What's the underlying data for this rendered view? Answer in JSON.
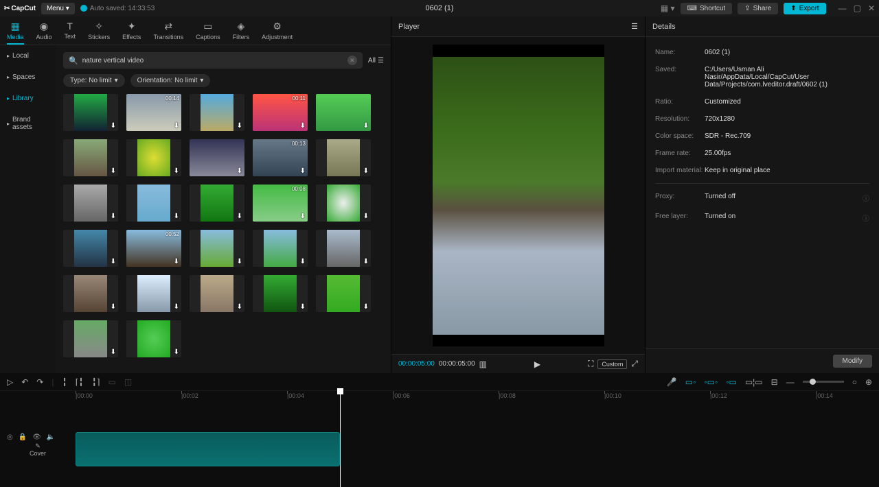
{
  "titlebar": {
    "logo": "CapCut",
    "menu": "Menu ▾",
    "autosave": "Auto saved: 14:33:53",
    "project": "0602 (1)",
    "shortcut": "Shortcut",
    "share": "Share",
    "export": "Export"
  },
  "tabs": [
    {
      "label": "Media",
      "icon": "▦"
    },
    {
      "label": "Audio",
      "icon": "◉"
    },
    {
      "label": "Text",
      "icon": "T"
    },
    {
      "label": "Stickers",
      "icon": "✧"
    },
    {
      "label": "Effects",
      "icon": "✦"
    },
    {
      "label": "Transitions",
      "icon": "⇄"
    },
    {
      "label": "Captions",
      "icon": "▭"
    },
    {
      "label": "Filters",
      "icon": "◈"
    },
    {
      "label": "Adjustment",
      "icon": "⚙"
    }
  ],
  "sidenav": [
    "Local",
    "Spaces",
    "Library",
    "Brand assets"
  ],
  "search": {
    "value": "nature vertical video",
    "all": "All"
  },
  "filters": {
    "type": "Type: No limit",
    "orientation": "Orientation: No limit"
  },
  "thumbs": [
    {
      "dur": "",
      "bg": "linear-gradient(#2a4, #123)"
    },
    {
      "dur": "00:14",
      "bg": "linear-gradient(#89a, #ccb)",
      "wide": true
    },
    {
      "dur": "",
      "bg": "linear-gradient(#5ad, #ba6)"
    },
    {
      "dur": "00:11",
      "bg": "linear-gradient(#f54, #b37)",
      "wide": true
    },
    {
      "dur": "",
      "bg": "linear-gradient(#5c5, #394)",
      "wide": true
    },
    {
      "dur": "",
      "bg": "linear-gradient(#8a7, #654)"
    },
    {
      "dur": "",
      "bg": "radial-gradient(#dd3, #6a2)"
    },
    {
      "dur": "",
      "bg": "linear-gradient(#335, #889)",
      "wide": true
    },
    {
      "dur": "00:13",
      "bg": "linear-gradient(#678, #345)",
      "wide": true
    },
    {
      "dur": "",
      "bg": "linear-gradient(#aa8, #775)"
    },
    {
      "dur": "",
      "bg": "linear-gradient(#aaa, #666)"
    },
    {
      "dur": "",
      "bg": "linear-gradient(#8bd, #6ac)"
    },
    {
      "dur": "",
      "bg": "linear-gradient(#3a3, #171)"
    },
    {
      "dur": "00:08",
      "bg": "linear-gradient(#4b4, #8c8)",
      "wide": true
    },
    {
      "dur": "",
      "bg": "radial-gradient(#eee, #3a3)"
    },
    {
      "dur": "",
      "bg": "linear-gradient(#48a, #234)"
    },
    {
      "dur": "00:52",
      "bg": "linear-gradient(#8bd, #432)",
      "wide": true
    },
    {
      "dur": "",
      "bg": "linear-gradient(#8bd, #6a3)"
    },
    {
      "dur": "",
      "bg": "linear-gradient(#8bd, #4a4)"
    },
    {
      "dur": "",
      "bg": "linear-gradient(#abc, #666)"
    },
    {
      "dur": "",
      "bg": "linear-gradient(#987, #543)"
    },
    {
      "dur": "",
      "bg": "linear-gradient(#def, #89a)"
    },
    {
      "dur": "",
      "bg": "linear-gradient(#ba8, #876)"
    },
    {
      "dur": "",
      "bg": "linear-gradient(#3a3, #151)"
    },
    {
      "dur": "",
      "bg": "linear-gradient(#5b3, #3a2)"
    },
    {
      "dur": "",
      "bg": "linear-gradient(#6a6, #888)"
    },
    {
      "dur": "",
      "bg": "radial-gradient(#5c5, #2a2)"
    }
  ],
  "player": {
    "title": "Player",
    "tc1": "00:00:05:00",
    "tc2": "00:00:05:00",
    "custom": "Custom"
  },
  "details": {
    "title": "Details",
    "rows": [
      {
        "label": "Name:",
        "value": "0602 (1)"
      },
      {
        "label": "Saved:",
        "value": "C:/Users/Usman Ali Nasir/AppData/Local/CapCut/User Data/Projects/com.lveditor.draft/0602 (1)"
      },
      {
        "label": "Ratio:",
        "value": "Customized"
      },
      {
        "label": "Resolution:",
        "value": "720x1280"
      },
      {
        "label": "Color space:",
        "value": "SDR - Rec.709"
      },
      {
        "label": "Frame rate:",
        "value": "25.00fps"
      },
      {
        "label": "Import material:",
        "value": "Keep in original place"
      }
    ],
    "rows2": [
      {
        "label": "Proxy:",
        "value": "Turned off"
      },
      {
        "label": "Free layer:",
        "value": "Turned on"
      }
    ],
    "modify": "Modify"
  },
  "timeline": {
    "ticks": [
      "00:00",
      "00:02",
      "00:04",
      "00:06",
      "00:08",
      "00:10",
      "00:12",
      "00:14"
    ],
    "cover": "Cover"
  }
}
